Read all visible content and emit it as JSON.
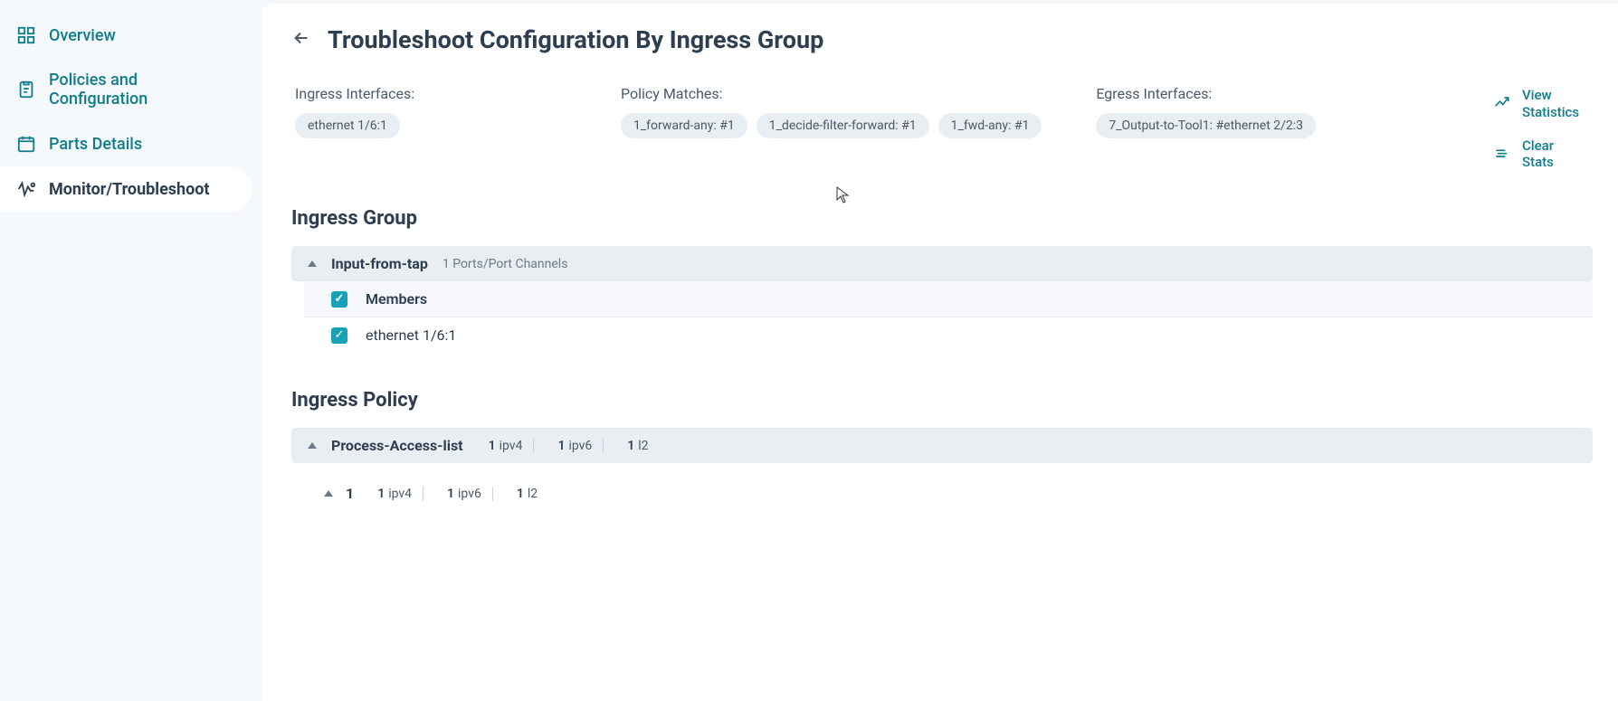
{
  "sidebar": {
    "items": [
      {
        "label": "Overview"
      },
      {
        "label": "Policies and Configuration"
      },
      {
        "label": "Parts Details"
      },
      {
        "label": "Monitor/Troubleshoot"
      }
    ]
  },
  "header": {
    "title": "Troubleshoot Configuration By Ingress Group"
  },
  "filters": {
    "ingress_label": "Ingress Interfaces:",
    "ingress_chips": [
      "ethernet 1/6:1"
    ],
    "policy_label": "Policy Matches:",
    "policy_chips": [
      "1_forward-any: #1",
      "1_decide-filter-forward: #1",
      "1_fwd-any: #1"
    ],
    "egress_label": "Egress Interfaces:",
    "egress_chips": [
      "7_Output-to-Tool1: #ethernet 2/2:3"
    ]
  },
  "actions": {
    "view_stats": "View Statistics",
    "clear_stats": "Clear Stats"
  },
  "ingress_group": {
    "section_title": "Ingress Group",
    "panel_name": "Input-from-tap",
    "panel_sub": "1 Ports/Port Channels",
    "members_label": "Members",
    "rows": [
      "ethernet 1/6:1"
    ]
  },
  "ingress_policy": {
    "section_title": "Ingress Policy",
    "panel_name": "Process-Access-list",
    "tags": [
      {
        "n": "1",
        "t": "ipv4"
      },
      {
        "n": "1",
        "t": "ipv6"
      },
      {
        "n": "1",
        "t": "l2"
      }
    ],
    "sub_index": "1",
    "sub_tags": [
      {
        "n": "1",
        "t": "ipv4"
      },
      {
        "n": "1",
        "t": "ipv6"
      },
      {
        "n": "1",
        "t": "l2"
      }
    ]
  }
}
